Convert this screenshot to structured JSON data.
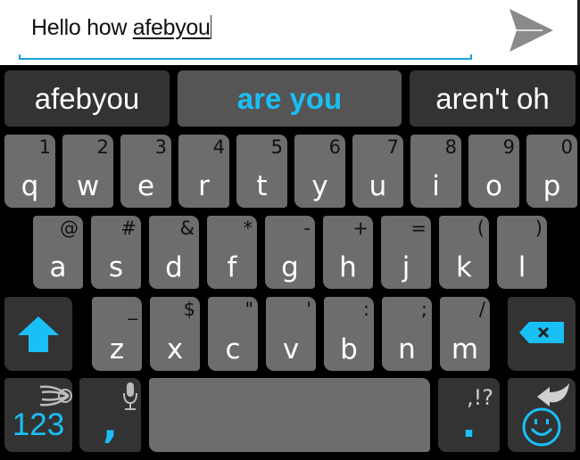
{
  "input": {
    "text_before": "Hello how ",
    "composing_word": "afebyou",
    "send_icon": "send-icon"
  },
  "colors": {
    "accent": "#19c0f5",
    "key_bg": "#6d6d6d",
    "function_key_bg": "#333333",
    "selected_suggestion_bg": "#555555",
    "underline": "#1aa4d6"
  },
  "suggestions": [
    {
      "label": "afebyou",
      "selected": false
    },
    {
      "label": "are you",
      "selected": true
    },
    {
      "label": "aren't oh",
      "selected": false
    }
  ],
  "keyboard": {
    "row1": [
      {
        "key": "q",
        "alt": "1"
      },
      {
        "key": "w",
        "alt": "2"
      },
      {
        "key": "e",
        "alt": "3"
      },
      {
        "key": "r",
        "alt": "4"
      },
      {
        "key": "t",
        "alt": "5"
      },
      {
        "key": "y",
        "alt": "6"
      },
      {
        "key": "u",
        "alt": "7"
      },
      {
        "key": "i",
        "alt": "8"
      },
      {
        "key": "o",
        "alt": "9"
      },
      {
        "key": "p",
        "alt": "0"
      }
    ],
    "row2": [
      {
        "key": "a",
        "alt": "@"
      },
      {
        "key": "s",
        "alt": "#"
      },
      {
        "key": "d",
        "alt": "&"
      },
      {
        "key": "f",
        "alt": "*"
      },
      {
        "key": "g",
        "alt": "-"
      },
      {
        "key": "h",
        "alt": "+"
      },
      {
        "key": "j",
        "alt": "="
      },
      {
        "key": "k",
        "alt": "("
      },
      {
        "key": "l",
        "alt": ")"
      }
    ],
    "row3": [
      {
        "key": "z",
        "alt": "_"
      },
      {
        "key": "x",
        "alt": "$"
      },
      {
        "key": "c",
        "alt": "\""
      },
      {
        "key": "v",
        "alt": "'"
      },
      {
        "key": "b",
        "alt": ":"
      },
      {
        "key": "n",
        "alt": ";"
      },
      {
        "key": "m",
        "alt": "/"
      }
    ],
    "shift_icon": "shift-icon",
    "backspace_icon": "backspace-icon",
    "symbols_label": "123",
    "swype_logo": "swiftkey-logo-icon",
    "comma_label": ",",
    "mic_icon": "microphone-icon",
    "period_label": ".",
    "period_alt": ",!?",
    "enter_icon": "enter-icon",
    "emoji_icon": "smiley-icon"
  }
}
